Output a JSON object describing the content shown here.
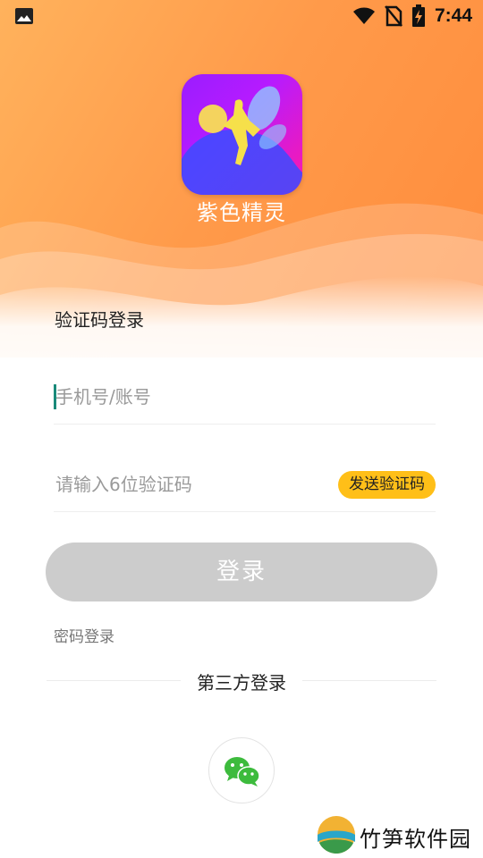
{
  "status_bar": {
    "time": "7:44",
    "icons": [
      "image-icon",
      "wifi-icon",
      "no-sim-icon",
      "battery-charging-icon"
    ]
  },
  "app": {
    "name": "紫色精灵",
    "logo_icon": "fairy-logo-icon"
  },
  "login": {
    "section_title": "验证码登录",
    "phone_placeholder": "手机号/账号",
    "code_placeholder": "请输入6位验证码",
    "send_code_label": "发送验证码",
    "login_label": "登录",
    "password_login_label": "密码登录",
    "third_party_label": "第三方登录",
    "third_party_icons": [
      "wechat-icon"
    ]
  },
  "watermark": {
    "text": "竹笋软件园"
  },
  "colors": {
    "hero_gradient_start": "#ffb25c",
    "hero_gradient_end": "#ff8a3a",
    "logo_gradient_start": "#9a1cff",
    "logo_gradient_end": "#ff1aa8",
    "send_code_bg": "#ffbf18",
    "login_button_bg": "#cccccc",
    "caret": "#1a8a7a",
    "wechat_green": "#3dbb3d"
  }
}
